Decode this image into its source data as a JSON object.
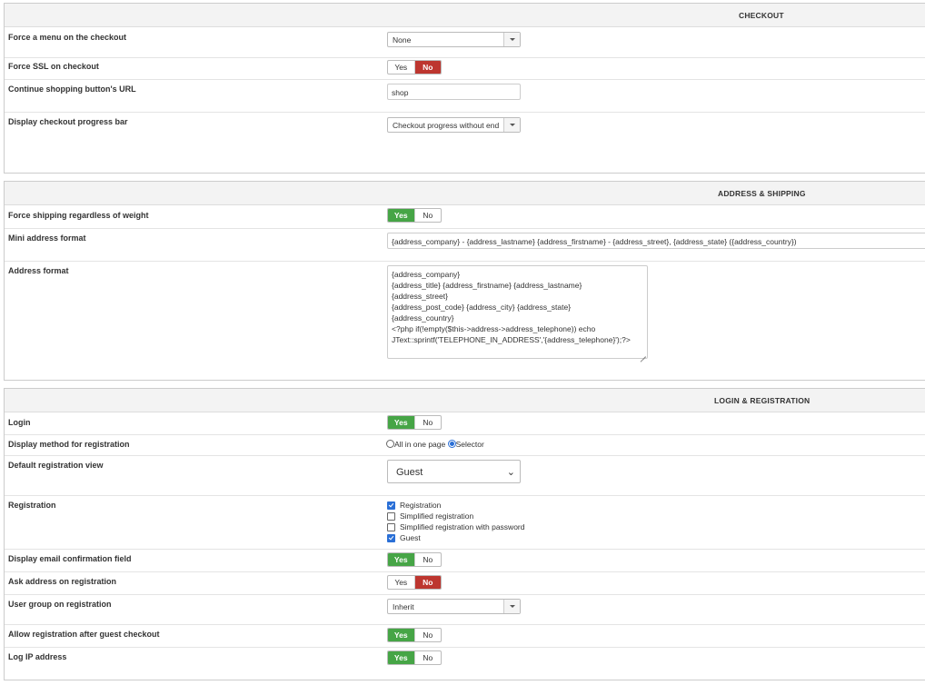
{
  "checkout": {
    "title": "CHECKOUT",
    "force_menu": {
      "label": "Force a menu on the checkout",
      "value": "None"
    },
    "force_ssl": {
      "label": "Force SSL on checkout",
      "yes": "Yes",
      "no": "No",
      "selected": "No"
    },
    "continue_url": {
      "label": "Continue shopping button's URL",
      "value": "shop"
    },
    "progress_bar": {
      "label": "Display checkout progress bar",
      "value": "Checkout progress without end"
    }
  },
  "address_shipping": {
    "title": "ADDRESS & SHIPPING",
    "force_shipping": {
      "label": "Force shipping regardless of weight",
      "yes": "Yes",
      "no": "No",
      "selected": "Yes"
    },
    "mini_address": {
      "label": "Mini address format",
      "value": "{address_company} - {address_lastname} {address_firstname} - {address_street}, {address_state} ({address_country})"
    },
    "address_format": {
      "label": "Address format",
      "lines": [
        "{address_company}",
        "{address_title} {address_firstname} {address_lastname}",
        "{address_street}",
        "{address_post_code} {address_city} {address_state}",
        "{address_country}",
        "<?php if(!empty($this->address->address_telephone)) echo",
        "JText::sprintf('TELEPHONE_IN_ADDRESS','{address_telephone}');?>"
      ]
    }
  },
  "login_registration": {
    "title": "LOGIN & REGISTRATION",
    "login": {
      "label": "Login",
      "yes": "Yes",
      "no": "No",
      "selected": "Yes"
    },
    "display_method": {
      "label": "Display method for registration",
      "options": [
        "All in one page",
        "Selector"
      ],
      "selected": "Selector"
    },
    "default_view": {
      "label": "Default registration view",
      "value": "Guest"
    },
    "registration": {
      "label": "Registration",
      "options": [
        {
          "text": "Registration",
          "checked": true
        },
        {
          "text": "Simplified registration",
          "checked": false
        },
        {
          "text": "Simplified registration with password",
          "checked": false
        },
        {
          "text": "Guest",
          "checked": true
        }
      ]
    },
    "email_confirm": {
      "label": "Display email confirmation field",
      "yes": "Yes",
      "no": "No",
      "selected": "Yes"
    },
    "ask_address": {
      "label": "Ask address on registration",
      "yes": "Yes",
      "no": "No",
      "selected": "No"
    },
    "user_group": {
      "label": "User group on registration",
      "value": "Inherit"
    },
    "allow_after_guest": {
      "label": "Allow registration after guest checkout",
      "yes": "Yes",
      "no": "No",
      "selected": "Yes"
    },
    "log_ip": {
      "label": "Log IP address",
      "yes": "Yes",
      "no": "No",
      "selected": "Yes"
    }
  },
  "colors": {
    "yes_active": "#46a546",
    "no_active": "#bd362f",
    "radio_checked": "#2a6fd6"
  }
}
